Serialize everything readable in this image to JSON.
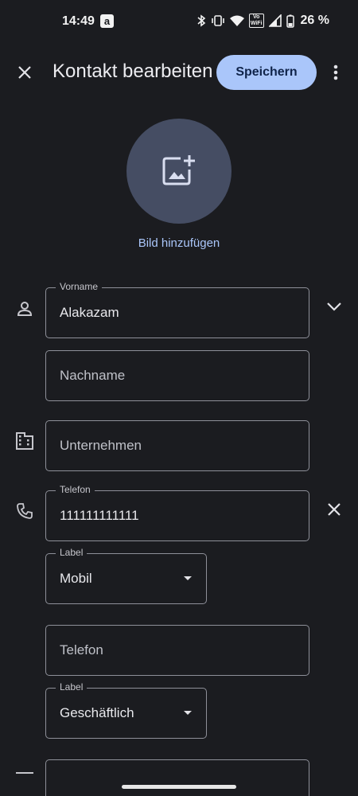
{
  "status_bar": {
    "time": "14:49",
    "notification_glyph": "a",
    "vowifi_top": "Vo",
    "vowifi_bottom": "WiFi",
    "battery_text": "26 %"
  },
  "app_bar": {
    "title": "Kontakt bearbeiten",
    "save_label": "Speichern",
    "close_icon": "close-icon",
    "more_icon": "more-vert-icon"
  },
  "photo": {
    "add_label": "Bild hinzufügen",
    "icon": "add-photo-icon"
  },
  "form": {
    "first_name": {
      "label": "Vorname",
      "value": "Alakazam"
    },
    "last_name": {
      "placeholder": "Nachname"
    },
    "company": {
      "placeholder": "Unternehmen"
    },
    "phone1": {
      "label": "Telefon",
      "value": "111111111111"
    },
    "phone1_type": {
      "label": "Label",
      "value": "Mobil"
    },
    "phone2": {
      "placeholder": "Telefon"
    },
    "phone2_type": {
      "label": "Label",
      "value": "Geschäftlich"
    }
  },
  "colors": {
    "background": "#1b1c20",
    "accent": "#aac6fa",
    "avatar_bg": "#454d63",
    "outline": "#8e9099"
  }
}
